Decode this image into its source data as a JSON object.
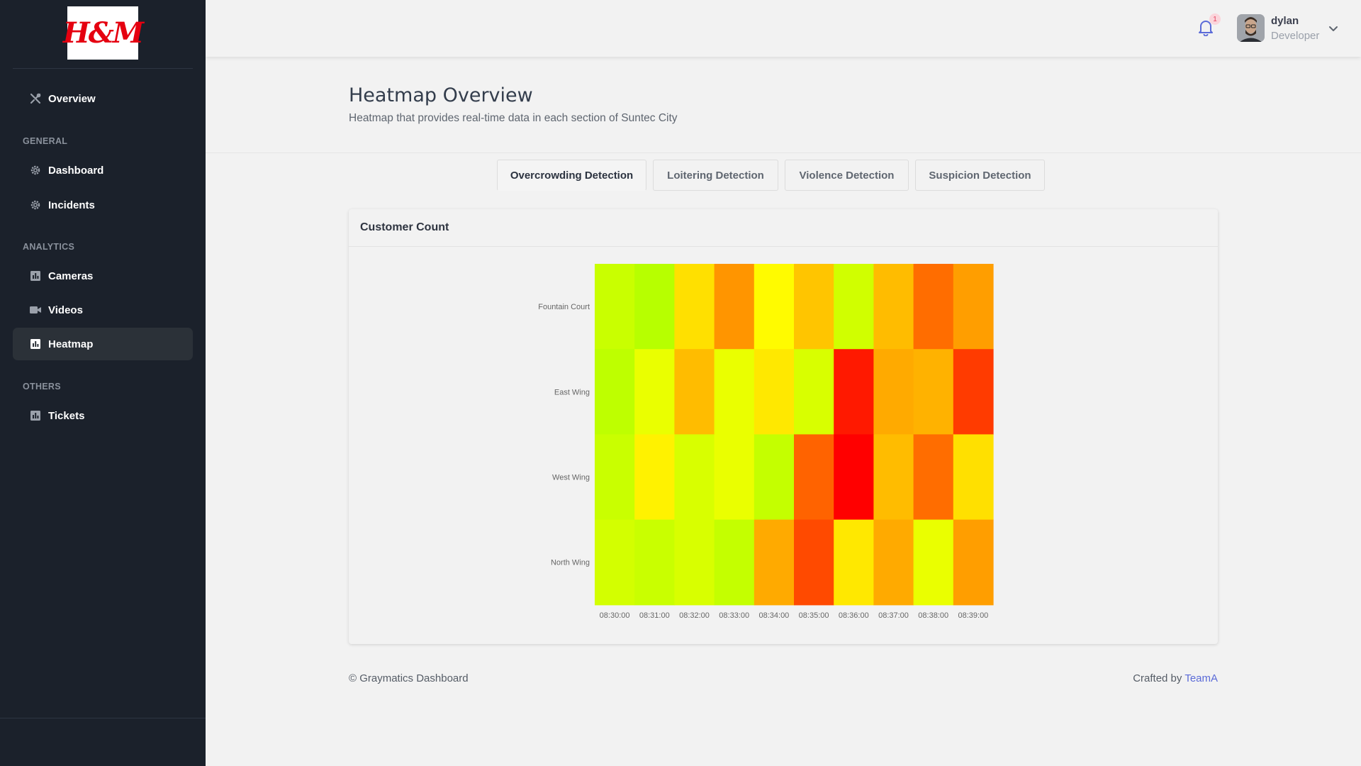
{
  "brand": {
    "logo_text": "H&M",
    "logo_color": "#e50010"
  },
  "sidebar": {
    "overview": {
      "label": "Overview",
      "icon": "tools-icon"
    },
    "sections": [
      {
        "title": "GENERAL",
        "items": [
          {
            "label": "Dashboard",
            "icon": "gear-icon"
          },
          {
            "label": "Incidents",
            "icon": "gear-icon"
          }
        ]
      },
      {
        "title": "ANALYTICS",
        "items": [
          {
            "label": "Cameras",
            "icon": "bar-chart-icon"
          },
          {
            "label": "Videos",
            "icon": "video-camera-icon"
          },
          {
            "label": "Heatmap",
            "icon": "bar-chart-icon",
            "active": true
          }
        ]
      },
      {
        "title": "OTHERS",
        "items": [
          {
            "label": "Tickets",
            "icon": "bar-chart-icon"
          }
        ]
      }
    ]
  },
  "header": {
    "notification_count": "1",
    "user": {
      "name": "dylan",
      "role": "Developer"
    }
  },
  "page": {
    "title": "Heatmap Overview",
    "subtitle": "Heatmap that provides real-time data in each section of Suntec City"
  },
  "tabs": [
    {
      "label": "Overcrowding Detection",
      "active": true
    },
    {
      "label": "Loitering Detection",
      "active": false
    },
    {
      "label": "Violence Detection",
      "active": false
    },
    {
      "label": "Suspicion Detection",
      "active": false
    }
  ],
  "card": {
    "title": "Customer Count"
  },
  "chart_data": {
    "type": "heatmap",
    "title": "",
    "x": [
      "08:30:00",
      "08:31:00",
      "08:32:00",
      "08:33:00",
      "08:34:00",
      "08:35:00",
      "08:36:00",
      "08:37:00",
      "08:38:00",
      "08:39:00"
    ],
    "y": [
      "Fountain Court",
      "East Wing",
      "West Wing",
      "North Wing"
    ],
    "values": [
      [
        0.12,
        0.05,
        0.45,
        0.7,
        0.35,
        0.55,
        0.15,
        0.58,
        0.78,
        0.68
      ],
      [
        0.08,
        0.25,
        0.58,
        0.25,
        0.42,
        0.18,
        0.95,
        0.65,
        0.62,
        0.88
      ],
      [
        0.12,
        0.38,
        0.18,
        0.25,
        0.1,
        0.8,
        1.0,
        0.58,
        0.78,
        0.45
      ],
      [
        0.16,
        0.12,
        0.18,
        0.1,
        0.65,
        0.85,
        0.42,
        0.65,
        0.25,
        0.68
      ]
    ],
    "colorscale": [
      "#aaff00",
      "#ffff00",
      "#ffa500",
      "#ff0000"
    ],
    "grid": false,
    "legend": "none"
  },
  "footer": {
    "left": "© Graymatics Dashboard",
    "crafted_prefix": "Crafted by",
    "crafted_link": "TeamA"
  }
}
